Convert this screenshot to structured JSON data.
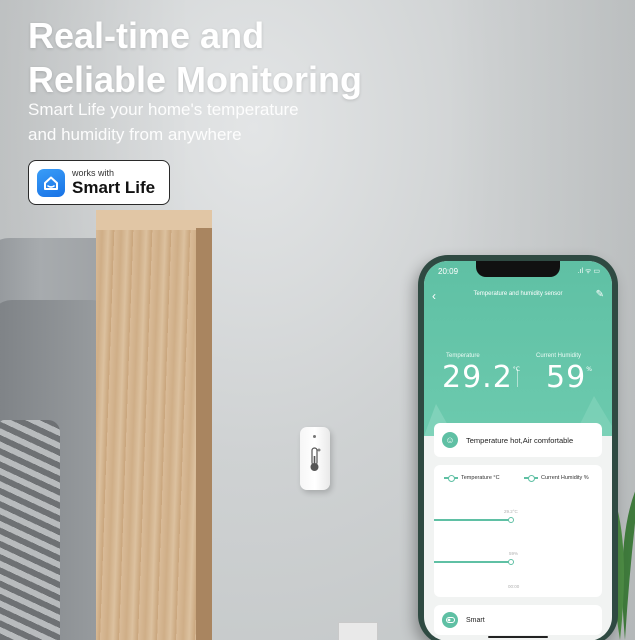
{
  "headline": {
    "line1": "Real-time and",
    "line2": "Reliable Monitoring"
  },
  "subtitle": {
    "line1": "Smart Life your home's temperature",
    "line2": "and humidity from anywhere"
  },
  "badge": {
    "small": "works with",
    "big": "Smart Life",
    "accent": "#1e82f0"
  },
  "app": {
    "status_time": "20:09",
    "status_icons": ".ıl ᯤ ▭",
    "title": "Temperature and humidity sensor",
    "temperature_label": "Temperature",
    "temperature_value": "29.2",
    "temperature_unit": "°C",
    "humidity_label": "Current Humidity",
    "humidity_value": "59",
    "humidity_unit": "%",
    "comfort_text": "Temperature hot,Air comfortable",
    "legend_temp": "Temperature °C",
    "legend_humidity": "Current Humidity %",
    "chart_temp_value": "29.2°C",
    "chart_humidity_value": "59%",
    "chart_time": "00:00",
    "smart_label": "Smart",
    "accent": "#5fc0a4"
  }
}
